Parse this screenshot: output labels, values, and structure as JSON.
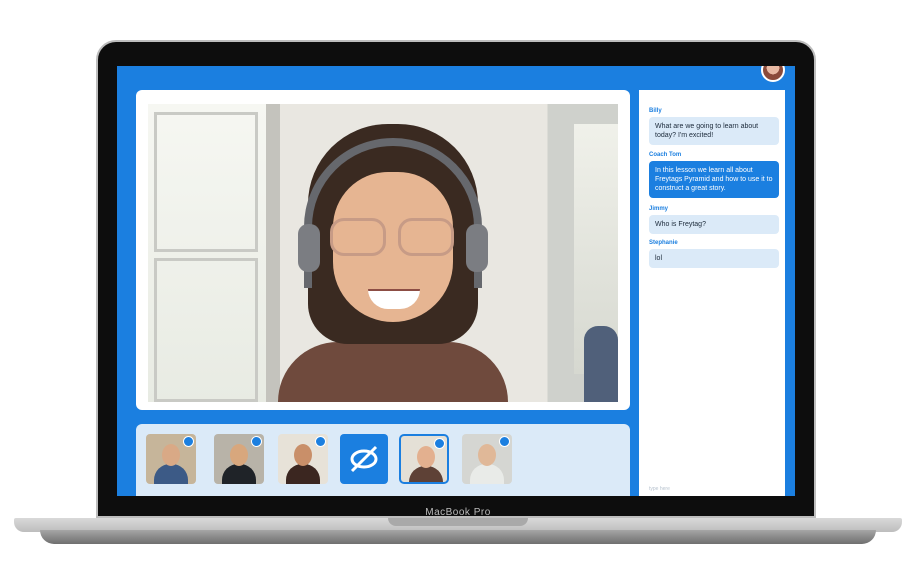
{
  "device": {
    "brand_label": "MacBook Pro"
  },
  "app": {
    "user_avatar_icon": "user-avatar",
    "main_video_icon": "video-feed",
    "participants": [
      {
        "name": "participant-1",
        "mic_icon": "mic-icon"
      },
      {
        "name": "participant-2",
        "mic_icon": "mic-icon"
      },
      {
        "name": "participant-3",
        "mic_icon": "mic-icon"
      },
      {
        "name": "screen-share",
        "icon": "screen-share-off-icon"
      },
      {
        "name": "participant-5",
        "mic_icon": "mic-icon"
      },
      {
        "name": "participant-6",
        "mic_icon": "mic-icon"
      }
    ],
    "accent_color": "#1b7fe0"
  },
  "chat": {
    "messages": [
      {
        "sender": "Billy",
        "text": "What are we going to learn about today? I'm excited!"
      },
      {
        "sender": "Coach Tom",
        "text": "In this lesson we learn all about Freytags Pyramid and how to use it to construct a great story."
      },
      {
        "sender": "Jimmy",
        "text": "Who is Freytag?"
      },
      {
        "sender": "Stephanie",
        "text": "lol"
      }
    ],
    "input_placeholder": "type here"
  }
}
